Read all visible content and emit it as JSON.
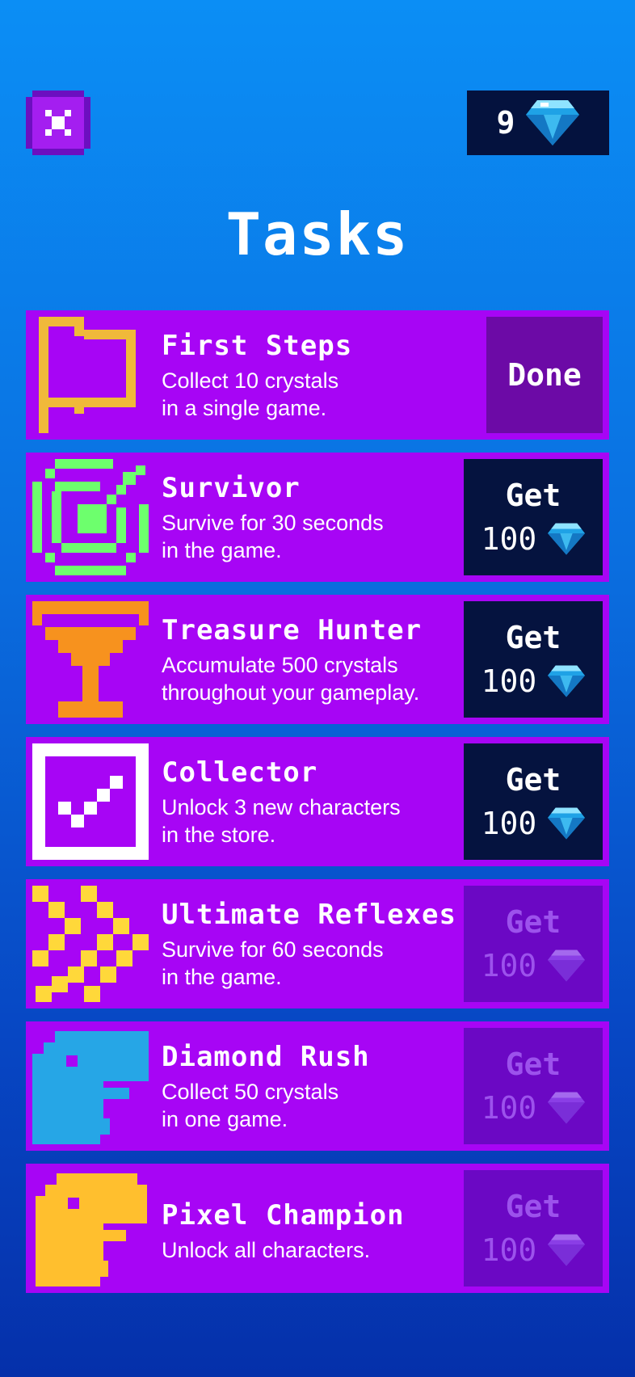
{
  "header": {
    "close_icon": "close-icon",
    "currency_value": "9",
    "currency_icon": "diamond-icon"
  },
  "title": "Tasks",
  "tasks": [
    {
      "icon": "flag-icon",
      "title": "First Steps",
      "description": "Collect 10 crystals\nin a single game.",
      "status": "done",
      "button_label": "Done"
    },
    {
      "icon": "target-icon",
      "title": "Survivor",
      "description": "Survive for 30 seconds\nin the game.",
      "status": "available",
      "button_label": "Get",
      "reward": "100"
    },
    {
      "icon": "trophy-icon",
      "title": "Treasure Hunter",
      "description": "Accumulate 500 crystals\nthroughout your gameplay.",
      "status": "available",
      "button_label": "Get",
      "reward": "100"
    },
    {
      "icon": "checkbox-icon",
      "title": "Collector",
      "description": "Unlock 3 new characters\nin the store.",
      "status": "available",
      "button_label": "Get",
      "reward": "100"
    },
    {
      "icon": "zigzag-icon",
      "title": "Ultimate Reflexes",
      "description": "Survive for 60 seconds\nin the game.",
      "status": "locked",
      "button_label": "Get",
      "reward": "100"
    },
    {
      "icon": "blue-dino-icon",
      "title": "Diamond Rush",
      "description": "Collect 50 crystals\nin one game.",
      "status": "locked",
      "button_label": "Get",
      "reward": "100"
    },
    {
      "icon": "yellow-dino-icon",
      "title": "Pixel Champion",
      "description": "Unlock all characters.",
      "status": "locked",
      "button_label": "Get",
      "reward": "100"
    }
  ],
  "colors": {
    "card": "#a705f5",
    "button_dark": "#05133f",
    "button_locked": "#6b08c4",
    "done": "#6c0aa6",
    "close_button": "#8f12e6"
  }
}
